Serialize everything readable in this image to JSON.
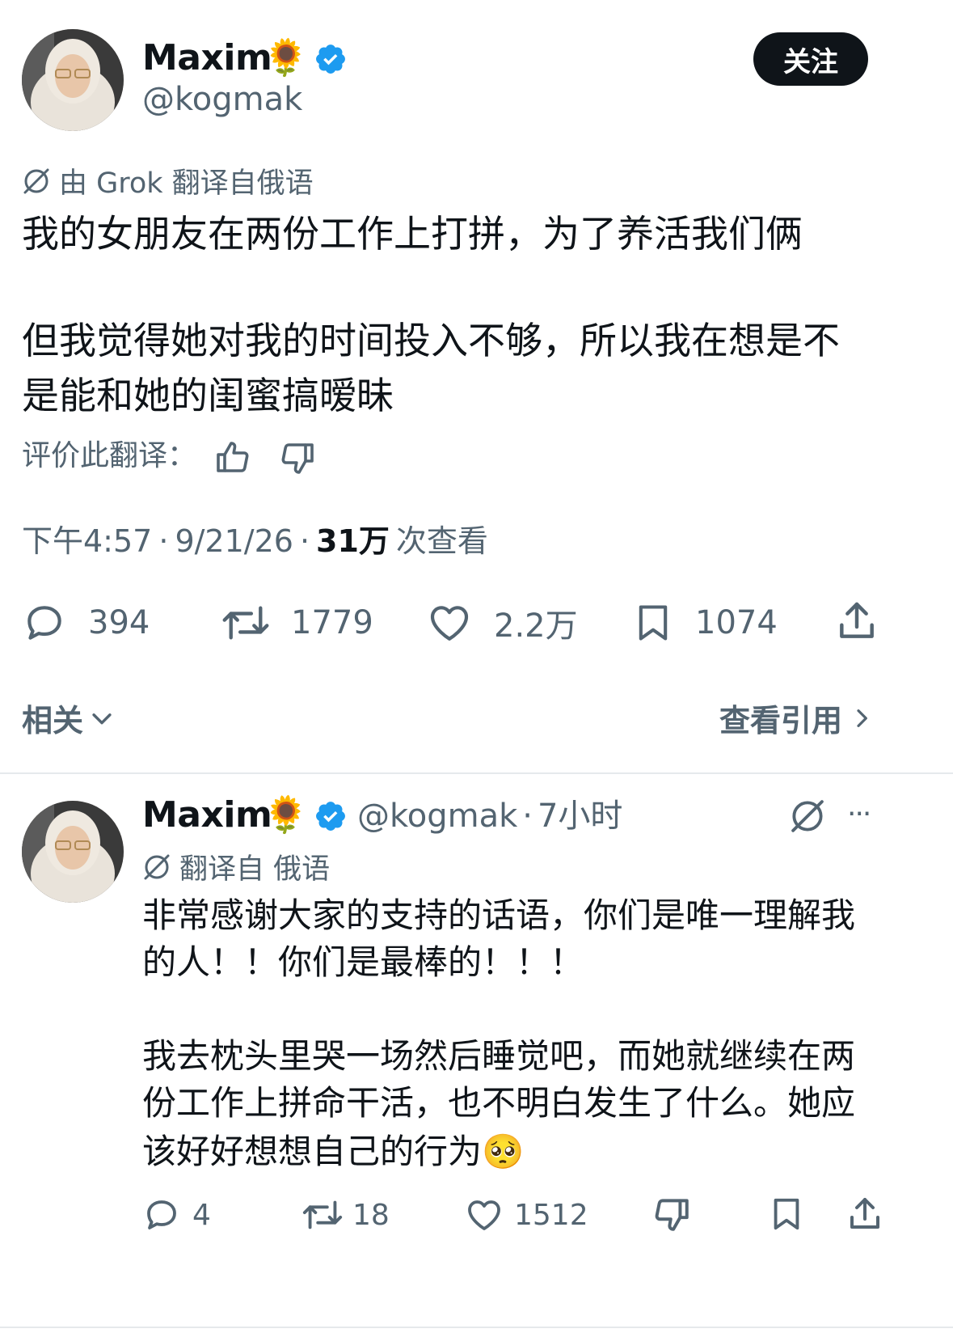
{
  "main_tweet": {
    "author_name": "Maxim",
    "author_emoji": "🌻",
    "handle": "@kogmak",
    "follow_label": "关注",
    "translation_label": "由 Grok 翻译自俄语",
    "text_p1": "我的女朋友在两份工作上打拼，为了养活我们俩",
    "text_p2_line1": "但我觉得她对我的时间投入不够，所以我在想是不",
    "text_p2_line2": "是能和她的闺蜜搞暧昧",
    "rate_label": "评价此翻译：",
    "time": "下午4:57",
    "date": "9/21/26",
    "views_count": "31万",
    "views_label": "次查看",
    "separator": "·",
    "stats": {
      "replies": "394",
      "retweets": "1779",
      "likes": "2.2万",
      "bookmarks": "1074"
    },
    "related_label": "相关",
    "quotes_label": "查看引用"
  },
  "reply_tweet": {
    "author_name": "Maxim",
    "author_emoji": "🌻",
    "handle": "@kogmak",
    "separator": "·",
    "time_ago": "7小时",
    "more_label": "···",
    "translation_label": "翻译自 俄语",
    "text_p1_line1": "非常感谢大家的支持的话语，你们是唯一理解我",
    "text_p1_line2": "的人！！你们是最棒的！！！",
    "text_p2_line1": "我去枕头里哭一场然后睡觉吧，而她就继续在两",
    "text_p2_line2": "份工作上拼命干活，也不明白发生了什么。她应",
    "text_p2_line3": "该好好想想自己的行为🥺",
    "stats": {
      "replies": "4",
      "retweets": "18",
      "likes": "1512"
    }
  },
  "colors": {
    "text": "#0f1419",
    "muted": "#536471",
    "verified": "#1d9bf0",
    "button_bg": "#0f1419",
    "divider": "#e6e9ec"
  },
  "icons": [
    "verified-badge-icon",
    "grok-translate-icon",
    "thumbs-up-icon",
    "thumbs-down-icon",
    "reply-icon",
    "retweet-icon",
    "like-icon",
    "bookmark-icon",
    "share-icon",
    "chevron-down-icon",
    "chevron-right-icon",
    "more-icon"
  ]
}
